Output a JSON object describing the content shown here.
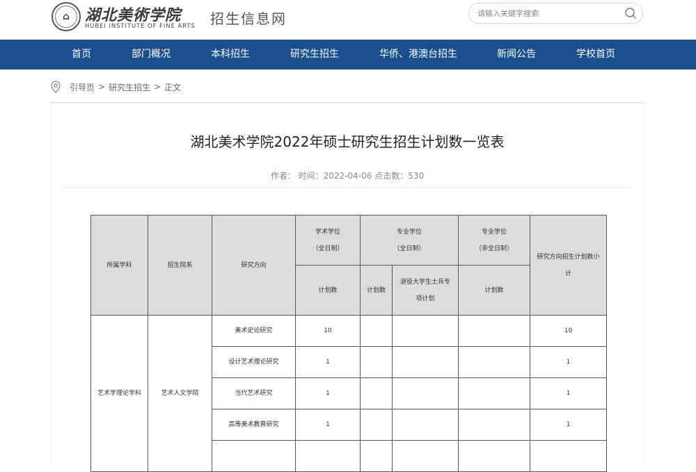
{
  "header": {
    "logo_cn": "湖北美術学院",
    "logo_en": "HUBEI INSTITUTE OF FINE ARTS",
    "site_name": "招生信息网",
    "search_placeholder": "请输入关键字搜索"
  },
  "nav": {
    "items": [
      {
        "label": "首页"
      },
      {
        "label": "部门概况"
      },
      {
        "label": "本科招生"
      },
      {
        "label": "研究生招生"
      },
      {
        "label": "华侨、港澳台招生"
      },
      {
        "label": "新闻公告"
      },
      {
        "label": "学校首页"
      }
    ]
  },
  "breadcrumb": {
    "items": [
      "引导页",
      "研究生招生",
      "正文"
    ],
    "separator": ">"
  },
  "article": {
    "title": "湖北美术学院2022年硕士研究生招生计划数一览表",
    "meta": "作者： 时间：2022-04-06 点击数：530"
  },
  "table": {
    "headers": {
      "discipline": "所属学科",
      "college": "招生院系",
      "direction": "研究方向",
      "academic_line1": "学术学位",
      "academic_line2": "（全日制）",
      "pro_full_line1": "专业学位",
      "pro_full_line2": "（全日制）",
      "pro_part_line1": "专业学位",
      "pro_part_line2": "（非全日制）",
      "subtotal_line1": "研究方向招生计划数小",
      "subtotal_line2": "计",
      "plan_count": "计划数",
      "veteran_line1": "退役大学生士兵专",
      "veteran_line2": "项计划"
    },
    "group": {
      "discipline": "艺术学理论学科",
      "college": "艺术人文学院"
    },
    "rows": [
      {
        "direction": "美术史论研究",
        "academic": "10",
        "pro_full": "",
        "veteran": "",
        "pro_part": "",
        "subtotal": "10"
      },
      {
        "direction": "设计艺术理论研究",
        "academic": "1",
        "pro_full": "",
        "veteran": "",
        "pro_part": "",
        "subtotal": "1"
      },
      {
        "direction": "当代艺术研究",
        "academic": "1",
        "pro_full": "",
        "veteran": "",
        "pro_part": "",
        "subtotal": "1"
      },
      {
        "direction": "高等美术教育研究",
        "academic": "1",
        "pro_full": "",
        "veteran": "",
        "pro_part": "",
        "subtotal": "1"
      },
      {
        "direction": "",
        "academic": "",
        "pro_full": "",
        "veteran": "",
        "pro_part": "",
        "subtotal": ""
      }
    ]
  },
  "colors": {
    "nav_bg": "#1b4f8e",
    "header_cell_bg": "#dcdcdc"
  }
}
